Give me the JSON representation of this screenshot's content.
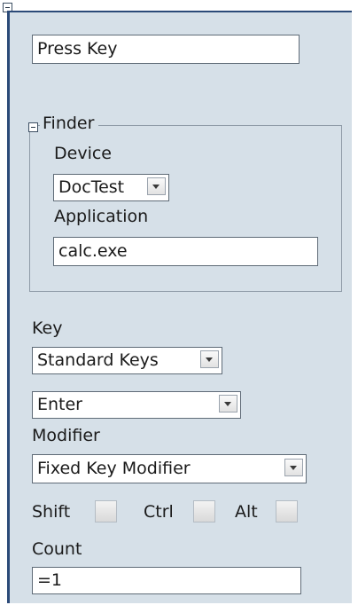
{
  "action": {
    "name_value": "Press Key"
  },
  "finder": {
    "legend": "Finder",
    "device_label": "Device",
    "device_value": "DocTest",
    "application_label": "Application",
    "application_value": "calc.exe"
  },
  "key": {
    "label": "Key",
    "category_value": "Standard Keys",
    "key_value": "Enter"
  },
  "modifier": {
    "label": "Modifier",
    "type_value": "Fixed Key Modifier",
    "shift_label": "Shift",
    "ctrl_label": "Ctrl",
    "alt_label": "Alt",
    "shift_checked": false,
    "ctrl_checked": false,
    "alt_checked": false
  },
  "count": {
    "label": "Count",
    "value": "=1"
  },
  "colors": {
    "panel_background": "#d6e0e8",
    "panel_border": "#2b4a78",
    "field_border": "#5f6b77"
  },
  "icons": {
    "collapse": "minus-box-icon",
    "dropdown": "chevron-down-icon"
  }
}
